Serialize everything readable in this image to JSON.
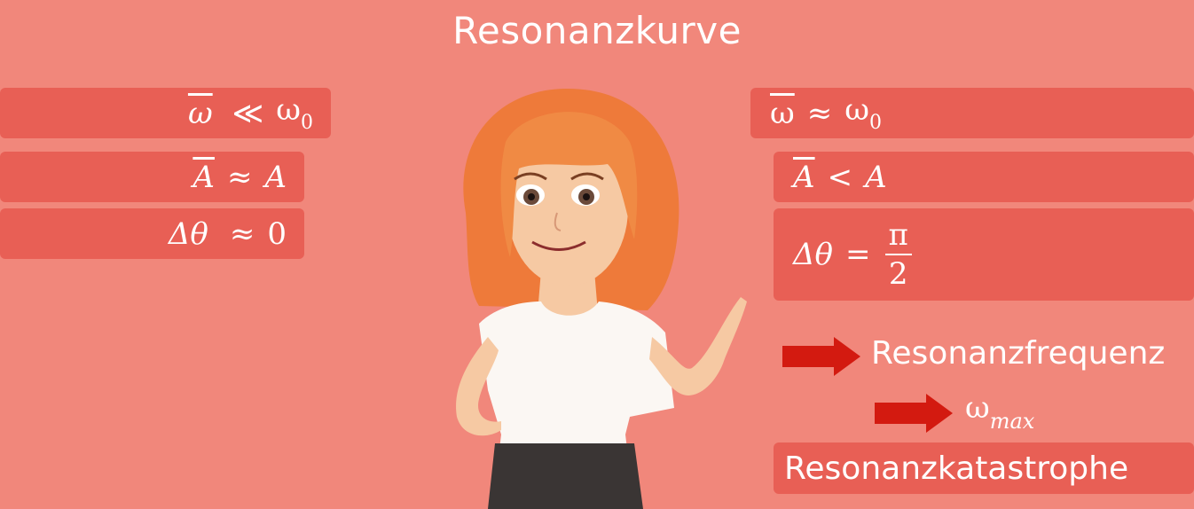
{
  "title": "Resonanzkurve",
  "left": {
    "row1": {
      "lhs": "ω",
      "rel": "≪",
      "rhs": "ω",
      "rhs_sub": "0"
    },
    "row2": {
      "lhs": "A",
      "rel": "≈",
      "rhs": "A"
    },
    "row3": {
      "lhs": "Δθ",
      "rel": "≈",
      "rhs": "0"
    }
  },
  "right": {
    "row1": {
      "lhs": "ω",
      "rel": "≈",
      "rhs": "ω",
      "rhs_sub": "0"
    },
    "row2": {
      "lhs": "A",
      "rel": "<",
      "rhs": "A"
    },
    "row3": {
      "lhs": "Δθ",
      "rel": "=",
      "num": "π",
      "den": "2"
    }
  },
  "resonanzfrequenz": "Resonanzfrequenz",
  "omega_max": {
    "symbol": "ω",
    "sub": "max"
  },
  "resonanzkatastrophe": "Resonanzkatastrophe",
  "colors": {
    "background": "#f1877b",
    "box": "#e85f55",
    "arrow": "#d31a10",
    "text": "#ffffff"
  }
}
